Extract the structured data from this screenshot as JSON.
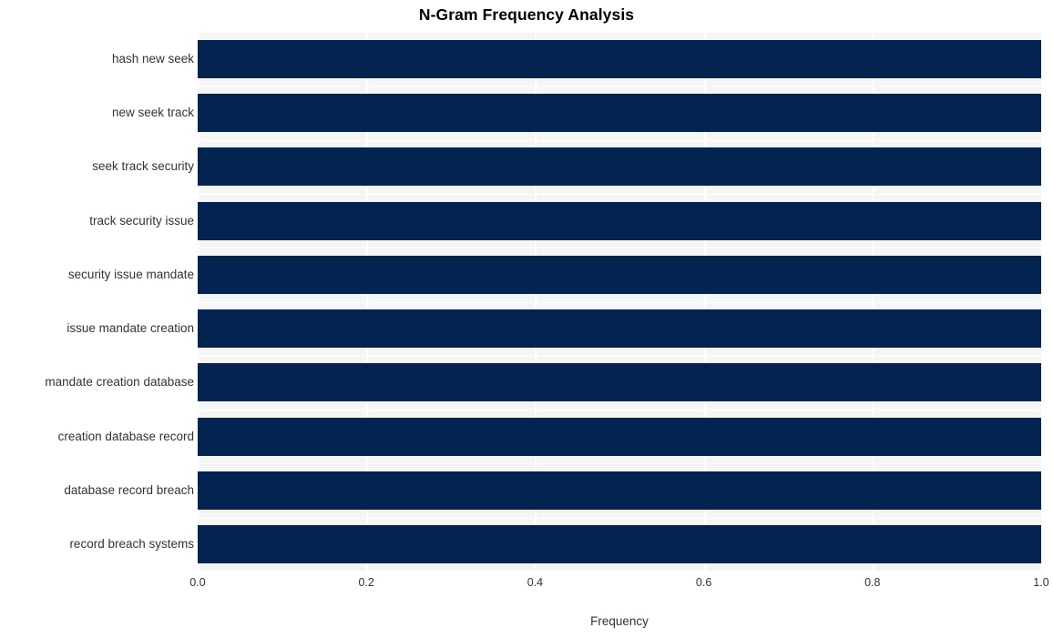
{
  "chart_data": {
    "type": "bar",
    "orientation": "horizontal",
    "title": "N-Gram Frequency Analysis",
    "xlabel": "Frequency",
    "ylabel": "",
    "categories": [
      "hash new seek",
      "new seek track",
      "seek track security",
      "track security issue",
      "security issue mandate",
      "issue mandate creation",
      "mandate creation database",
      "creation database record",
      "database record breach",
      "record breach systems"
    ],
    "values": [
      1.0,
      1.0,
      1.0,
      1.0,
      1.0,
      1.0,
      1.0,
      1.0,
      1.0,
      1.0
    ],
    "xlim": [
      0.0,
      1.0
    ],
    "xticks": [
      0.0,
      0.2,
      0.4,
      0.6,
      0.8,
      1.0
    ],
    "xtick_labels": [
      "0.0",
      "0.2",
      "0.4",
      "0.6",
      "0.8",
      "1.0"
    ],
    "grid": true,
    "legend": null,
    "bar_color": "#032450",
    "plot_background": "#f5f5f5",
    "gridline_color": "#ffffff",
    "figure_background": "#ffffff",
    "text_color": "#333333",
    "title_color": "#000000"
  }
}
